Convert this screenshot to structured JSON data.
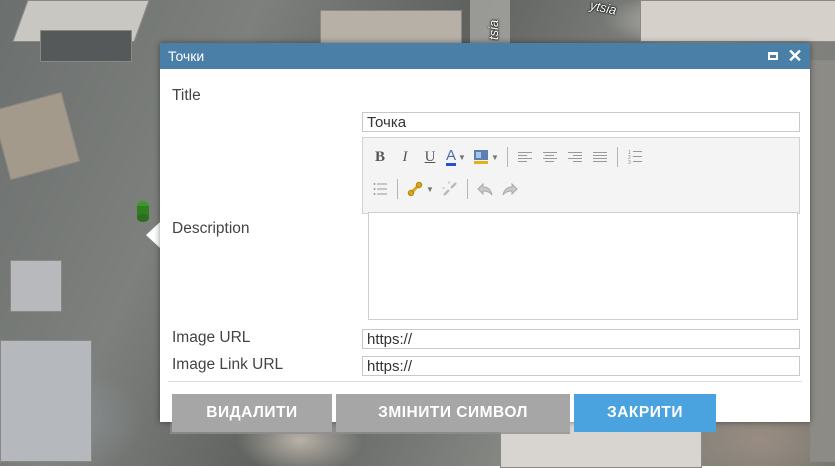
{
  "map": {
    "street_label_top": "ytsia",
    "street_label_vertical": "tsia"
  },
  "popup": {
    "title": "Точки",
    "maximize_icon": "maximize-icon",
    "close_icon": "close-icon",
    "close_glyph": "✕",
    "fields": {
      "title_label": "Title",
      "title_value": "Точка",
      "description_label": "Description",
      "image_url_label": "Image URL",
      "image_url_value": "https://",
      "image_link_url_label": "Image Link URL",
      "image_link_url_value": "https://"
    },
    "toolbar": {
      "bold": "B",
      "italic": "I",
      "underline": "U",
      "font_color": "A"
    },
    "buttons": {
      "delete": "ВИДАЛИТИ",
      "change_symbol": "ЗМІНИТИ СИМВОЛ",
      "close": "ЗАКРИТИ"
    }
  },
  "colors": {
    "titlebar": "#4a7fa8",
    "button_grey": "#a6a6a6",
    "button_blue": "#4aa3df",
    "marker": "#3c9a2a"
  }
}
